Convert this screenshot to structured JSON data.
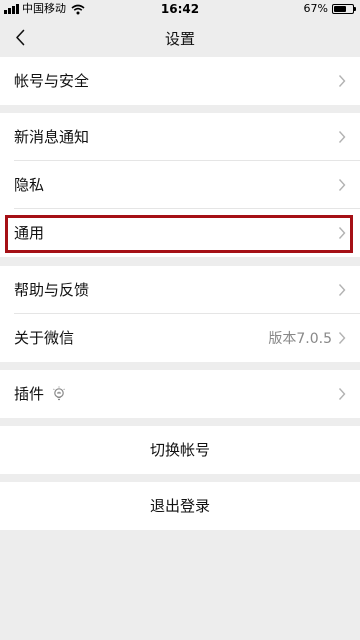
{
  "status_bar": {
    "carrier": "中国移动",
    "time": "16:42",
    "battery_percent": "67%",
    "battery_level": 0.67,
    "signal_icon": "cellular-signal-icon",
    "wifi_icon": "wifi-icon"
  },
  "nav": {
    "title": "设置",
    "back_icon": "chevron-left-icon"
  },
  "rows": {
    "account_security": "帐号与安全",
    "new_message_notify": "新消息通知",
    "privacy": "隐私",
    "general": "通用",
    "help_feedback": "帮助与反馈",
    "about_wechat": "关于微信",
    "about_version": "版本7.0.5",
    "plugins": "插件",
    "switch_account": "切换帐号",
    "logout": "退出登录"
  },
  "colors": {
    "background": "#ededed",
    "row_background": "#ffffff",
    "highlight_border": "#a51016",
    "secondary_text": "#888888",
    "chevron": "#b2b2b2"
  }
}
